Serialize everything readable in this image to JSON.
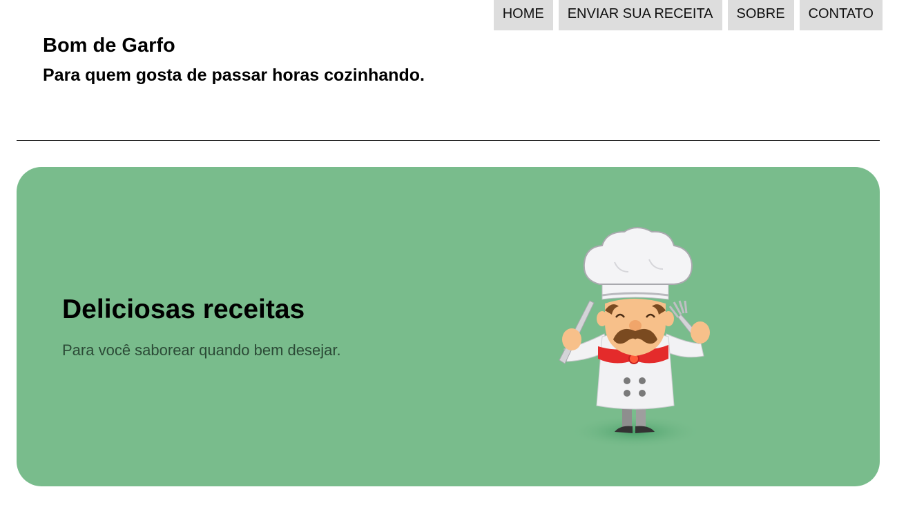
{
  "nav": {
    "items": [
      {
        "label": "HOME"
      },
      {
        "label": "ENVIAR SUA RECEITA"
      },
      {
        "label": "SOBRE"
      },
      {
        "label": "CONTATO"
      }
    ]
  },
  "header": {
    "title": "Bom de Garfo",
    "subtitle": "Para quem gosta de passar horas cozinhando."
  },
  "hero": {
    "title": "Deliciosas receitas",
    "text": "Para você saborear quando bem desejar.",
    "image": "chef-illustration",
    "background_color": "#79bc8c"
  },
  "colors": {
    "nav_background": "#dddddd",
    "scarf": "#e02020",
    "hat": "#f0f0f2"
  }
}
